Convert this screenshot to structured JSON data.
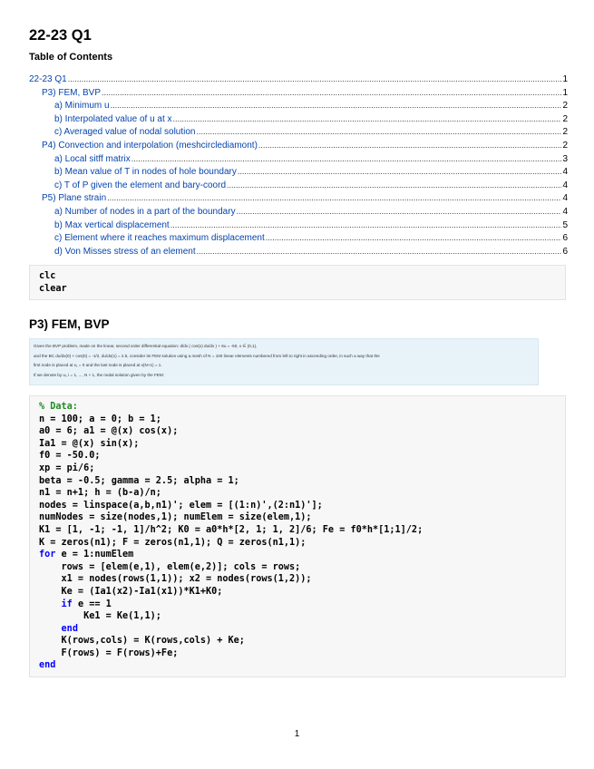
{
  "title": "22-23 Q1",
  "toc": {
    "heading": "Table of Contents",
    "items": [
      {
        "label": "22-23 Q1",
        "page": "1",
        "level": 0
      },
      {
        "label": "P3) FEM, BVP",
        "page": "1",
        "level": 1
      },
      {
        "label": "a) Minimum u",
        "page": "2",
        "level": 2
      },
      {
        "label": "b) Interpolated value of u at x",
        "page": "2",
        "level": 2
      },
      {
        "label": "c) Averaged value of nodal solution",
        "page": "2",
        "level": 2
      },
      {
        "label": "P4) Convection and interpolation (meshcirclediamont)",
        "page": "2",
        "level": 1
      },
      {
        "label": "a) Local sitff matrix",
        "page": "3",
        "level": 2
      },
      {
        "label": "b) Mean value of T in nodes of hole boundary",
        "page": "4",
        "level": 2
      },
      {
        "label": "c) T of P given the element and bary-coord",
        "page": "4",
        "level": 2
      },
      {
        "label": "P5) Plane strain",
        "page": "4",
        "level": 1
      },
      {
        "label": "a) Number of nodes in a part of the boundary",
        "page": "4",
        "level": 2
      },
      {
        "label": "b) Max vertical displacement",
        "page": "5",
        "level": 2
      },
      {
        "label": "c) Element where it reaches maximum displacement",
        "page": "6",
        "level": 2
      },
      {
        "label": "d) Von Misses stress of an element",
        "page": "6",
        "level": 2
      }
    ]
  },
  "code1": {
    "lines": [
      "clc",
      "clear"
    ]
  },
  "section1": {
    "heading": "P3) FEM, BVP",
    "problem_lines": [
      "Given the BVP problem, made on the linear, second order differential equation:  d/dx ( cos(x) du/dx ) + 6u = -50,      x ∈ (0,1),",
      "and the BC  du/dx(0) + cos(0) = -1/2,   du/dx(1) = 2.5, consider its FEM solution using a mesh of N = 100 linear elements numbered from left to right in ascending order, in such a way that the",
      "first node is placed at x₁ = 0 and the last node is placed at x(N+1) = 1.",
      "If we denote by uᵢ, i = 1, ..., N + 1, the nodal solution given by the FEM:"
    ]
  },
  "code2": {
    "lines": [
      "% Data:",
      "n = 100; a = 0; b = 1;",
      "a0 = 6; a1 = @(x) cos(x);",
      "Ia1 = @(x) sin(x);",
      "f0 = -50.0;",
      "xp = pi/6;",
      "beta = -0.5; gamma = 2.5; alpha = 1;",
      "n1 = n+1; h = (b-a)/n;",
      "nodes = linspace(a,b,n1)'; elem = [(1:n)',(2:n1)'];",
      "numNodes = size(nodes,1); numElem = size(elem,1);",
      "K1 = [1, -1; -1, 1]/h^2; K0 = a0*h*[2, 1; 1, 2]/6; Fe = f0*h*[1;1]/2;",
      "K = zeros(n1); F = zeros(n1,1); Q = zeros(n1,1);",
      "for e = 1:numElem",
      "    rows = [elem(e,1), elem(e,2)]; cols = rows;",
      "    x1 = nodes(rows(1,1)); x2 = nodes(rows(1,2));",
      "    Ke = (Ia1(x2)-Ia1(x1))*K1+K0;",
      "    if e == 1",
      "        Ke1 = Ke(1,1);",
      "    end",
      "    K(rows,cols) = K(rows,cols) + Ke;",
      "    F(rows) = F(rows)+Fe;",
      "end"
    ],
    "comment_lines": [
      0
    ],
    "keywords": [
      "for",
      "if",
      "end"
    ]
  },
  "page_number": "1"
}
